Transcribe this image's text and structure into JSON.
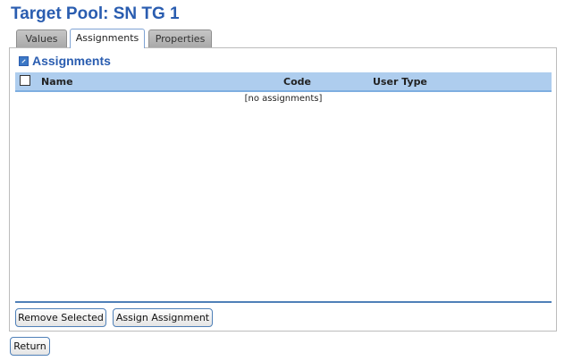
{
  "page": {
    "title": "Target Pool: SN TG 1"
  },
  "tabs": [
    {
      "label": "Values",
      "active": false
    },
    {
      "label": "Assignments",
      "active": true
    },
    {
      "label": "Properties",
      "active": false
    }
  ],
  "section": {
    "title": "Assignments",
    "icon": "edit-icon"
  },
  "table": {
    "columns": [
      "Name",
      "Code",
      "User Type"
    ],
    "rows": [],
    "empty_message": "[no assignments]"
  },
  "actions": {
    "remove_selected": "Remove Selected",
    "assign_assignment": "Assign Assignment",
    "return": "Return"
  },
  "colors": {
    "title": "#2a5db0",
    "header_bg": "#aecdee",
    "accent": "#4f80b8"
  }
}
